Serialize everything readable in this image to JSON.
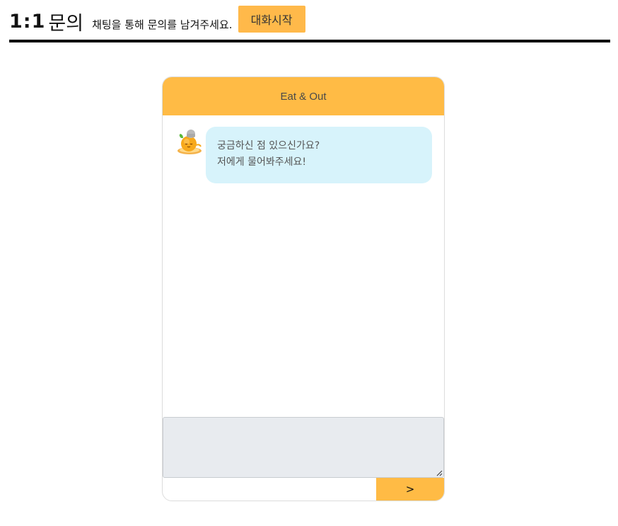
{
  "page": {
    "title_number": "1:1",
    "title_text": "문의",
    "subtitle": "채팅을 통해 문의를 남겨주세요.",
    "start_button_label": "대화시작"
  },
  "chat": {
    "header_title": "Eat & Out",
    "bot_avatar_icon": "orange-mascot-icon",
    "messages": [
      {
        "sender": "bot",
        "lines": [
          "궁금하신 점 있으신가요?",
          "저에게 물어봐주세요!"
        ]
      }
    ],
    "input": {
      "value": "",
      "placeholder": ""
    },
    "send_button_label": ">"
  },
  "colors": {
    "accent": "#ffbb45",
    "bubble_bg": "#d7f3fb",
    "input_bg": "#e8ebef",
    "divider": "#000000"
  }
}
